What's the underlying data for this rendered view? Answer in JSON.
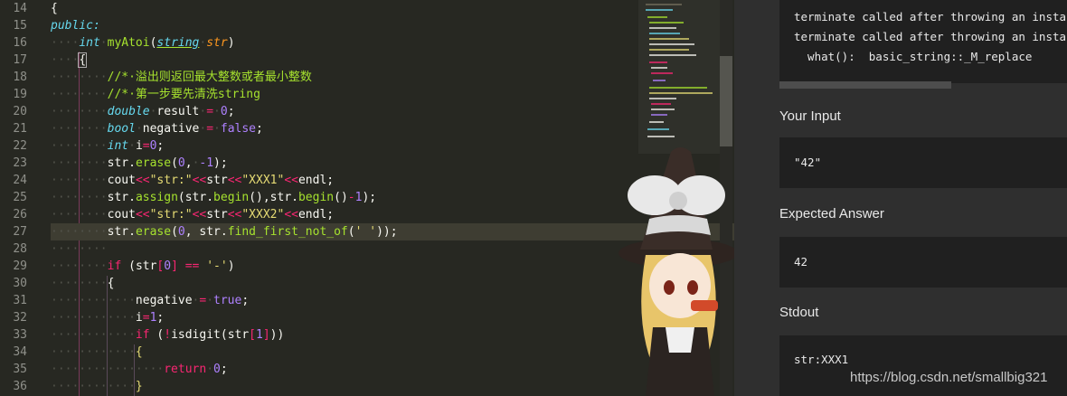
{
  "editor": {
    "line_numbers": [
      "14",
      "15",
      "16",
      "17",
      "18",
      "19",
      "20",
      "21",
      "22",
      "23",
      "24",
      "25",
      "26",
      "27",
      "28",
      "29",
      "30",
      "31",
      "32",
      "33",
      "34",
      "35",
      "36"
    ],
    "active_line": "27",
    "line_14": "{",
    "line_15": "public:",
    "line_16": {
      "type": "int",
      "name": "myAtoi",
      "param_type": "string",
      "param": "str"
    },
    "line_17": "{",
    "line_18": "//*·溢出则返回最大整数或者最小整数",
    "line_19": "//*·第一步要先清洗string",
    "line_20": {
      "type": "double",
      "name": "result",
      "op": "=",
      "value": "0",
      "end": ";"
    },
    "line_21": {
      "type": "bool",
      "name": "negative",
      "op": "=",
      "value": "false",
      "end": ";"
    },
    "line_22": {
      "type": "int",
      "name": "i",
      "op": "=",
      "value": "0",
      "end": ";"
    },
    "line_23": {
      "obj": "str.",
      "fn": "erase",
      "open": "(",
      "a": "0",
      "sep": ",",
      "b": "-1",
      "close": ");"
    },
    "line_24": {
      "a": "cout",
      "op1": "<<",
      "s1": "\"str:\"",
      "op2": "<<",
      "v": "str",
      "op3": "<<",
      "s2": "\"XXX1\"",
      "op4": "<<",
      "e": "endl;"
    },
    "line_25": {
      "obj": "str.",
      "fn": "assign",
      "open": "(",
      "b1": "str.",
      "f1": "begin",
      "p1": "(),",
      "b2": "str.",
      "f2": "begin",
      "p2": "()",
      "op": "-",
      "n": "1",
      "close": ");"
    },
    "line_26": {
      "a": "cout",
      "op1": "<<",
      "s1": "\"str:\"",
      "op2": "<<",
      "v": "str",
      "op3": "<<",
      "s2": "\"XXX2\"",
      "op4": "<<",
      "e": "endl;"
    },
    "line_27": {
      "obj": "str.",
      "fn": "erase",
      "open": "(",
      "a": "0",
      "sep": ", str.",
      "fn2": "find_first_not_of",
      "open2": "(",
      "s": "' '",
      "close": "));"
    },
    "line_28": "",
    "line_29": {
      "kw": "if",
      "open": " (",
      "v": "str",
      "idx_open": "[",
      "idx": "0",
      "idx_close": "]",
      "op": " == ",
      "s": "'-'",
      "close": ")"
    },
    "line_30": "{",
    "line_31": {
      "name": "negative",
      "op": "=",
      "value": "true",
      "end": ";"
    },
    "line_32": {
      "name": "i",
      "op": "=",
      "value": "1",
      "end": ";"
    },
    "line_33": {
      "kw": "if",
      "open": " (",
      "not": "!",
      "fn": "isdigit",
      "p_open": "(",
      "v": "str",
      "idx_open": "[",
      "idx": "1",
      "idx_close": "]",
      "close": "))"
    },
    "line_34": "{",
    "line_35": {
      "kw": "return",
      "value": "0",
      "end": ";"
    },
    "line_36": "}"
  },
  "panel": {
    "error_line_1": "terminate called after throwing an insta",
    "error_line_2": "terminate called after throwing an insta",
    "error_line_3": "  what():  basic_string::_M_replace",
    "your_input_title": "Your Input",
    "your_input_value": "\"42\"",
    "expected_title": "Expected Answer",
    "expected_value": "42",
    "stdout_title": "Stdout",
    "stdout_value": "str:XXX1"
  },
  "watermark": "https://blog.csdn.net/smallbig321",
  "colors": {
    "editor_bg": "#272822",
    "keyword": "#f92672",
    "type": "#66d9ef",
    "function": "#a6e22e",
    "string": "#e6db74",
    "number": "#ae81ff",
    "panel_bg": "#2f2f2f",
    "output_box_bg": "#202020"
  }
}
